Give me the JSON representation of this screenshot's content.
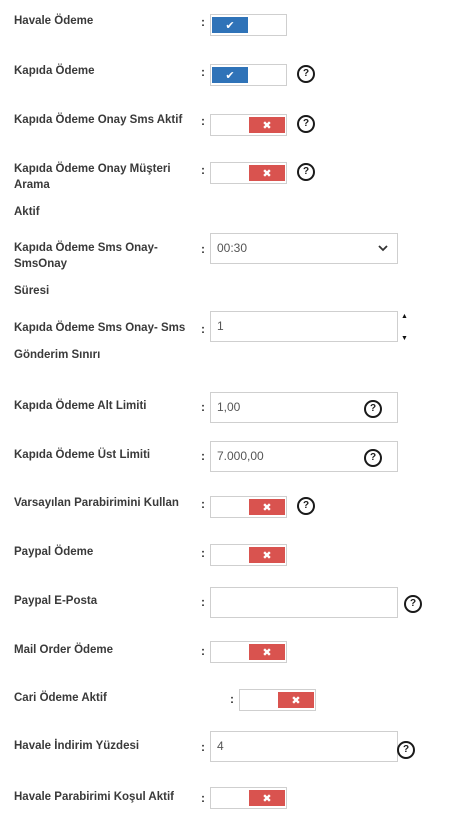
{
  "colon": ":",
  "help_glyph": "?",
  "rows": {
    "havale_odeme": {
      "label": "Havale Ödeme",
      "state": "on"
    },
    "kapida_odeme": {
      "label": "Kapıda Ödeme",
      "state": "on"
    },
    "kapida_onay_sms": {
      "label": "Kapıda Ödeme Onay Sms Aktif",
      "state": "off"
    },
    "kapida_onay_musteri": {
      "label_line1": "Kapıda Ödeme Onay Müşteri Arama",
      "label_line2": "Aktif",
      "state": "off"
    },
    "kapida_sms_suresi": {
      "label_line1": "Kapıda Ödeme Sms Onay- SmsOnay",
      "label_line2": "Süresi",
      "value": "00:30"
    },
    "kapida_sms_siniri": {
      "label_line1": "Kapıda Ödeme Sms Onay- Sms",
      "label_line2": "Gönderim Sınırı",
      "value": "1"
    },
    "kapida_alt_limit": {
      "label": "Kapıda Ödeme Alt Limiti",
      "value": "1,00"
    },
    "kapida_ust_limit": {
      "label": "Kapıda Ödeme Üst Limiti",
      "value": "7.000,00"
    },
    "varsayilan_para": {
      "label": "Varsayılan Parabirimini Kullan",
      "state": "off"
    },
    "paypal_odeme": {
      "label": "Paypal Ödeme",
      "state": "off"
    },
    "paypal_eposta": {
      "label": "Paypal E-Posta",
      "value": ""
    },
    "mail_order": {
      "label": "Mail Order Ödeme",
      "state": "off"
    },
    "cari_odeme": {
      "label": "Cari Ödeme Aktif",
      "state": "off"
    },
    "havale_indirim": {
      "label": "Havale İndirim Yüzdesi",
      "value": "4"
    },
    "havale_parabirimi": {
      "label": "Havale Parabirimi Koşul Aktif",
      "state": "off"
    }
  },
  "colors": {
    "on": "#2f73b8",
    "off": "#d9534f",
    "border": "#cfcfcf"
  },
  "icons": {
    "on": "check-icon",
    "off": "x-icon",
    "help": "question-circle-icon",
    "select": "chevron-down-icon",
    "spin_up": "triangle-up-icon",
    "spin_down": "triangle-down-icon"
  }
}
